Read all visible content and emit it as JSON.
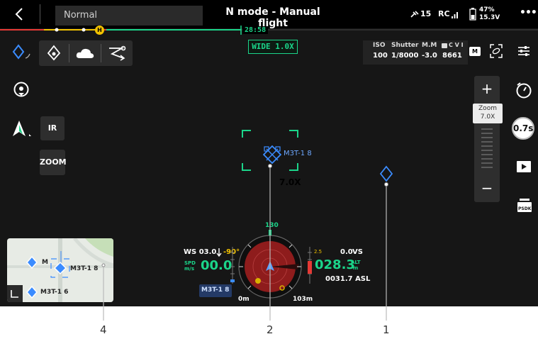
{
  "topbar": {
    "mode": "Normal",
    "title": "N mode - Manual flight",
    "satellites": "15",
    "rc_label": "RC",
    "battery_pct": "47%",
    "battery_voltage": "15.3V",
    "more": "•••"
  },
  "timeline": {
    "time": "28:58",
    "home_marker": "H"
  },
  "camera": {
    "lens_badge": "WIDE 1.0X",
    "iso_label": "ISO",
    "iso_value": "100",
    "shutter_label": "Shutter",
    "shutter_value": "1/8000",
    "mm_label": "M.M",
    "mm_value": "-3.0",
    "storage_label": "C V I",
    "storage_value": "8661",
    "mode_badge": "M"
  },
  "left_panel": {
    "ir_button": "IR",
    "zoom_button": "ZOOM"
  },
  "zoom_slider": {
    "plus": "+",
    "minus": "−",
    "label": "Zoom",
    "value": "7.0X"
  },
  "right_rail": {
    "shutter_time": "0.7s",
    "psdk": "PSDK"
  },
  "target": {
    "label": "M3T-1 8",
    "zoom": "7.0X"
  },
  "flight": {
    "ws_label": "WS 03.0",
    "ws_angle": "-90°",
    "spd_label_1": "SPD",
    "spd_label_2": "m/s",
    "spd_value": "00.0",
    "vs_value": "0.0",
    "vs_label": "VS",
    "alt_value": "028.3",
    "alt_label_1": "ALT",
    "alt_label_2": "m",
    "asl": "0031.7 ASL",
    "heading": "130",
    "alt_mark": "2.5",
    "device_badge": "M3T-1 8",
    "dist_left": "0m",
    "dist_right": "103m"
  },
  "minimap": {
    "label_top_partial": "M",
    "label_center": "M3T-1 8",
    "label_bottom": "M3T-1 6"
  },
  "callouts": {
    "c4": "4",
    "c2": "2",
    "c1": "1"
  },
  "colors": {
    "accent_green": "#1bd58a",
    "accent_yellow": "#f2c200",
    "accent_blue": "#3b8cff",
    "warning_red": "#e53935",
    "compass_red": "#8e1c1c"
  }
}
